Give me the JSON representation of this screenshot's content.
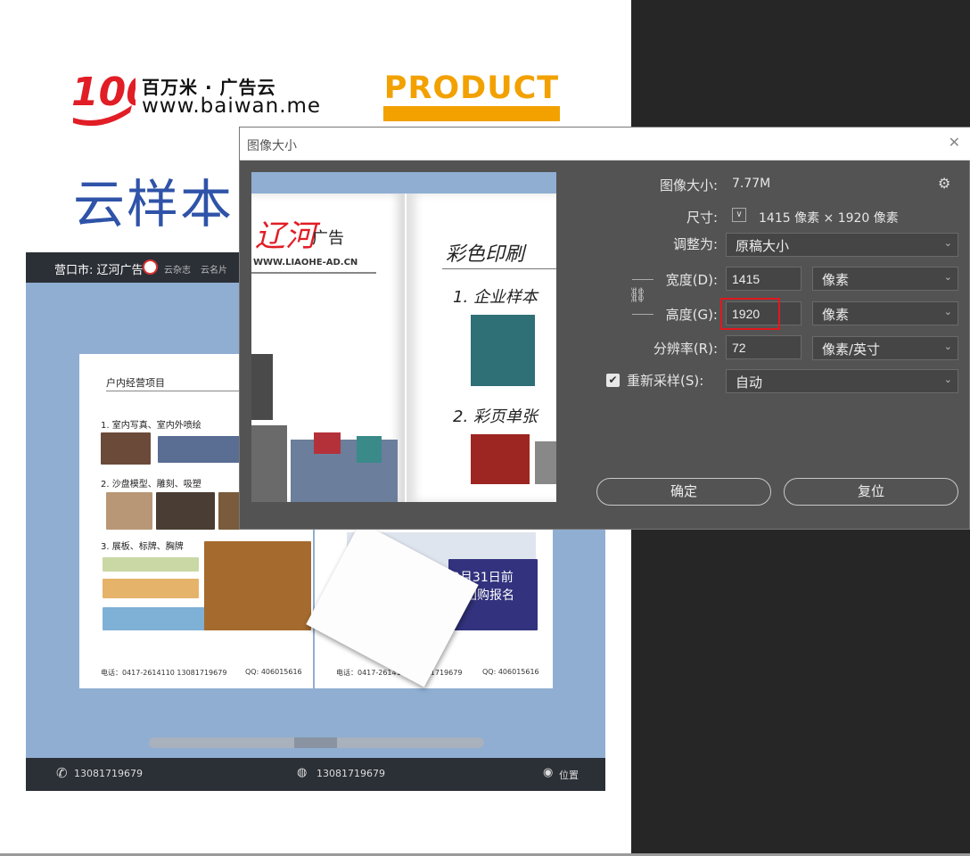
{
  "website": {
    "logo_number": "100",
    "brand_name": "百万米 · 广告云",
    "url": "www.baiwan.me",
    "product_badge": "PRODUCT",
    "page_title": "云样本"
  },
  "phone_preview": {
    "header_title": "营口市: 辽河广告",
    "header_link_1": "云杂志",
    "header_link_2": "云名片",
    "left_page": {
      "heading": "户内经营项目",
      "item1": "1. 室内写真、室内外喷绘",
      "item2": "2. 沙盘模型、雕刻、吸塑",
      "item3": "3. 展板、标牌、胸牌",
      "footer_phone": "电话：0417-2614110  13081719679",
      "footer_qq": "QQ: 406015616"
    },
    "right_page": {
      "footer_phone": "电话：0417-2614110  13081719679",
      "footer_qq": "QQ: 406015616",
      "ad_line1": "2月31日前",
      "ad_line2": "大团购报名"
    },
    "bottom_phone": "13081719679",
    "bottom_wechat": "13081719679",
    "bottom_location": "位置"
  },
  "dialog": {
    "title": "图像大小",
    "close_icon": "close-icon",
    "image_size_label": "图像大小:",
    "image_size_value": "7.77M",
    "dimensions_label": "尺寸:",
    "dimensions_value": "1415 像素  ×  1920 像素",
    "fit_to_label": "调整为:",
    "fit_to_value": "原稿大小",
    "width_label": "宽度(D):",
    "width_value": "1415",
    "width_unit": "像素",
    "height_label": "高度(G):",
    "height_value": "1920",
    "height_unit": "像素",
    "resolution_label": "分辨率(R):",
    "resolution_value": "72",
    "resolution_unit": "像素/英寸",
    "resample_label": "重新采样(S):",
    "resample_checked": true,
    "resample_value": "自动",
    "ok_button": "确定",
    "reset_button": "复位",
    "preview": {
      "brand": "辽河",
      "brand_suffix": "广告",
      "url": "WWW.LIAOHE-AD.CN",
      "heading": "彩色印刷",
      "item1": "1. 企业样本",
      "item2": "2. 彩页单张"
    }
  },
  "colors": {
    "accent_red": "#e0181e",
    "product_orange": "#f2a100",
    "title_blue": "#2f53a8"
  }
}
